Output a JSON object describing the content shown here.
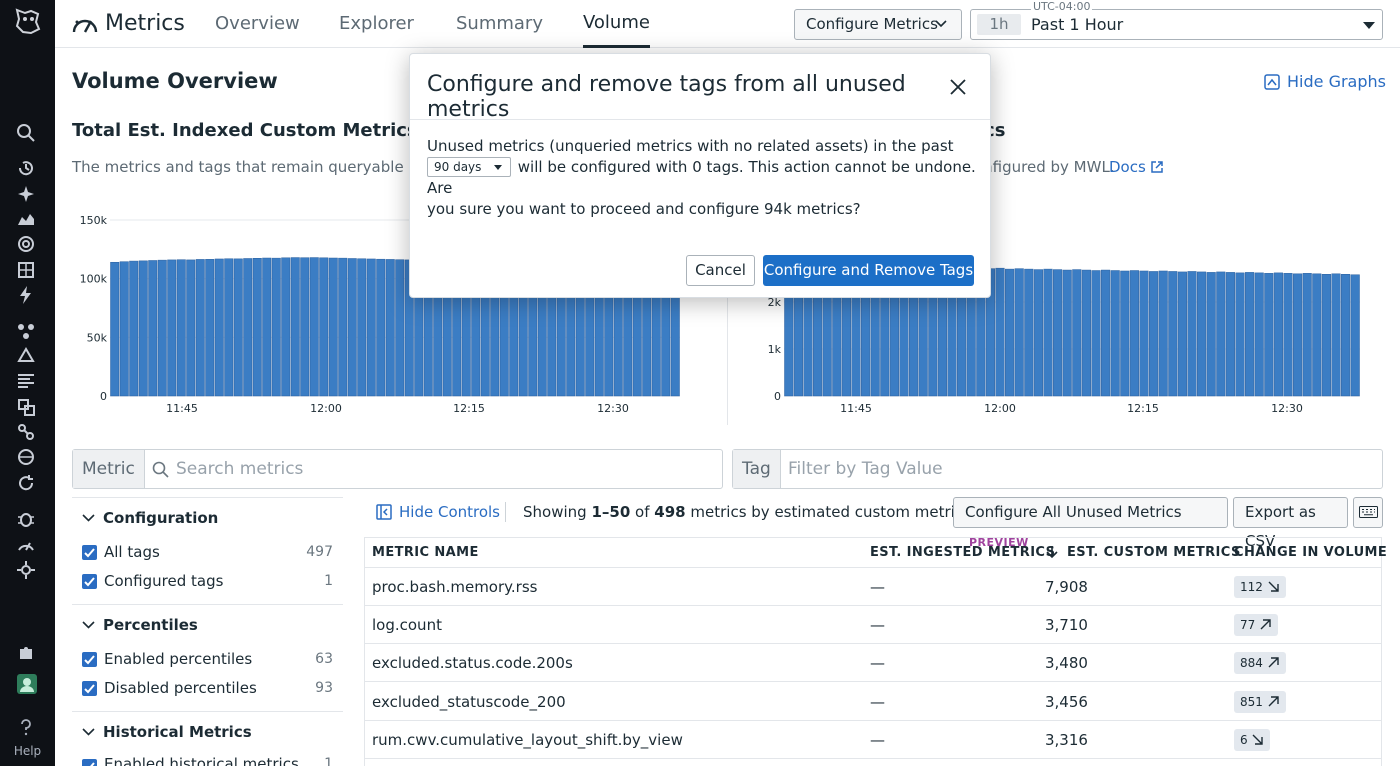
{
  "nav": {
    "help_label": "Help"
  },
  "topbar": {
    "app_title": "Metrics",
    "tabs": [
      {
        "label": "Overview"
      },
      {
        "label": "Explorer"
      },
      {
        "label": "Summary"
      },
      {
        "label": "Volume",
        "active": true
      }
    ],
    "configure_metrics_label": "Configure Metrics",
    "time_chip": "1h",
    "time_label": "Past 1 Hour",
    "timezone": "UTC-04:00"
  },
  "main": {
    "title": "Volume Overview",
    "hide_graphs_label": "Hide Graphs",
    "left_chart": {
      "title": "Total Est. Indexed Custom Metrics",
      "description": "The metrics and tags that remain queryable in Dat"
    },
    "right_chart": {
      "title_fragment": "rics",
      "description_fragment": "onfigured by MWL.",
      "docs_label": "Docs"
    }
  },
  "chart_data": [
    {
      "type": "bar",
      "title": "Total Est. Indexed Custom Metrics",
      "xlabel": "",
      "ylabel": "",
      "ylim": [
        0,
        150000
      ],
      "yticks": [
        "0",
        "50k",
        "100k",
        "150k"
      ],
      "xticks": [
        "11:45",
        "12:00",
        "12:15",
        "12:30"
      ],
      "grid": true,
      "values_note_range": "values between ~113000 and ~118000",
      "values": [
        114000,
        114500,
        115000,
        115200,
        115500,
        115800,
        116000,
        116200,
        116000,
        116400,
        116500,
        116800,
        117000,
        116900,
        117200,
        117400,
        117600,
        117500,
        117800,
        118000,
        117900,
        118000,
        117800,
        117600,
        117500,
        117200,
        117000,
        116800,
        116600,
        116400,
        116200,
        116000,
        115800,
        115600,
        115500,
        115300,
        115200,
        115000,
        114800,
        114700,
        114600,
        114500,
        114400,
        114300,
        114200,
        114100,
        114000,
        113900,
        113800,
        113700,
        113600,
        113500,
        113400,
        113300,
        113200,
        113100,
        113000,
        113000,
        113000,
        113000
      ]
    },
    {
      "type": "bar",
      "title": "",
      "xlabel": "",
      "ylabel": "",
      "ylim": [
        0,
        3000
      ],
      "yticks": [
        "0",
        "1k",
        "2k"
      ],
      "xticks": [
        "11:45",
        "12:00",
        "12:15",
        "12:30"
      ],
      "grid": true,
      "values": [
        2680,
        2690,
        2700,
        2710,
        2700,
        2720,
        2710,
        2730,
        2720,
        2740,
        2730,
        2720,
        2740,
        2730,
        2750,
        2740,
        2730,
        2720,
        2740,
        2730,
        2720,
        2710,
        2720,
        2700,
        2710,
        2700,
        2690,
        2700,
        2690,
        2680,
        2690,
        2680,
        2670,
        2680,
        2670,
        2660,
        2670,
        2660,
        2650,
        2660,
        2650,
        2640,
        2650,
        2640,
        2630,
        2640,
        2630,
        2620,
        2630,
        2620,
        2610,
        2620,
        2610,
        2600,
        2610,
        2600,
        2590,
        2600,
        2590,
        2580
      ]
    }
  ],
  "search": {
    "metric_prefix": "Metric",
    "metric_placeholder": "Search metrics",
    "tag_prefix": "Tag",
    "tag_placeholder": "Filter by Tag Value"
  },
  "facets": {
    "configuration": {
      "title": "Configuration",
      "items": [
        {
          "label": "All tags",
          "count": "497"
        },
        {
          "label": "Configured tags",
          "count": "1"
        }
      ]
    },
    "percentiles": {
      "title": "Percentiles",
      "items": [
        {
          "label": "Enabled percentiles",
          "count": "63"
        },
        {
          "label": "Disabled percentiles",
          "count": "93"
        }
      ]
    },
    "historical": {
      "title": "Historical Metrics",
      "items": [
        {
          "label": "Enabled historical metrics",
          "count": "1"
        }
      ]
    }
  },
  "table": {
    "hide_controls_label": "Hide Controls",
    "showing_prefix": "Showing",
    "showing_range": "1–50",
    "showing_of": "of",
    "showing_total": "498",
    "showing_suffix": "metrics by estimated custom metrics",
    "configure_unused_label": "Configure All Unused Metrics",
    "preview_badge": "PREVIEW",
    "export_label": "Export as CSV",
    "headers": {
      "name": "METRIC NAME",
      "ingested": "EST. INGESTED METRICS",
      "custom": "EST. CUSTOM METRICS",
      "change": "CHANGE IN VOLUME"
    },
    "rows": [
      {
        "name": "proc.bash.memory.rss",
        "ingested": "—",
        "custom": "7,908",
        "change": "112",
        "direction": "down"
      },
      {
        "name": "log.count",
        "ingested": "—",
        "custom": "3,710",
        "change": "77",
        "direction": "up"
      },
      {
        "name": "excluded.status.code.200s",
        "ingested": "—",
        "custom": "3,480",
        "change": "884",
        "direction": "up"
      },
      {
        "name": "excluded_statuscode_200",
        "ingested": "—",
        "custom": "3,456",
        "change": "851",
        "direction": "up"
      },
      {
        "name": "rum.cwv.cumulative_layout_shift.by_view",
        "ingested": "—",
        "custom": "3,316",
        "change": "6",
        "direction": "down"
      }
    ]
  },
  "modal": {
    "title": "Configure and remove tags from all unused metrics",
    "body_line1": "Unused metrics (unqueried metrics with no related assets) in the past",
    "days_value": "90 days",
    "body_line2": "will be configured with 0 tags. This action cannot be undone. Are",
    "body_line3": "you sure you want to proceed and configure 94k metrics?",
    "cancel_label": "Cancel",
    "confirm_label": "Configure and Remove Tags"
  },
  "colors": {
    "bar": "#3b7dc4",
    "bar_edge": "#2a5f9e",
    "primary": "#1c6fc7",
    "nav_bg": "#0e1116"
  }
}
